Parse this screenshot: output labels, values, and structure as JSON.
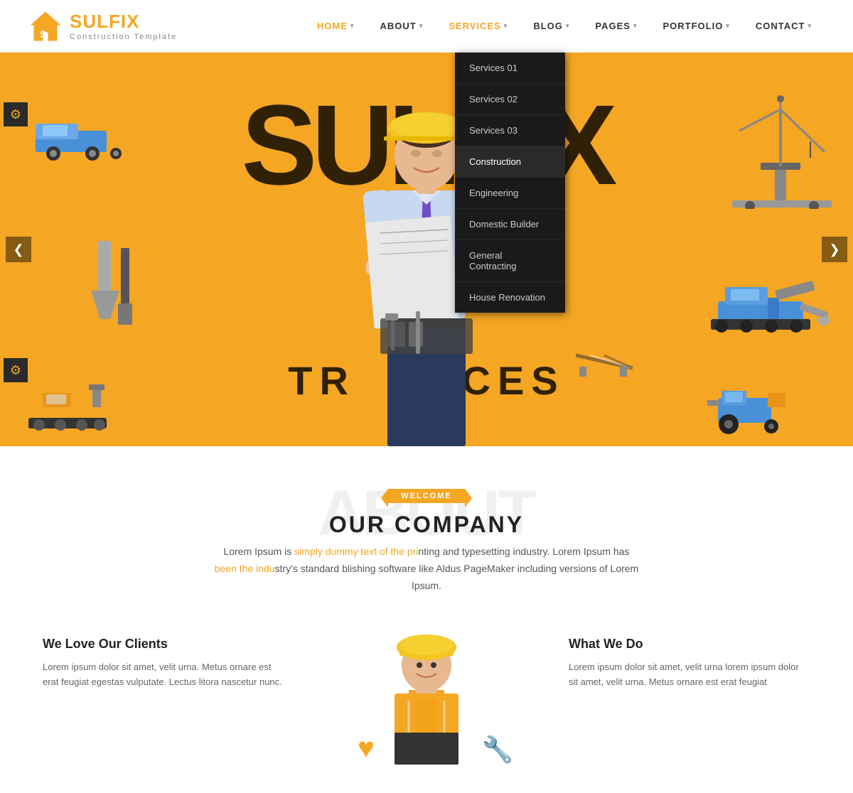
{
  "header": {
    "logo_name_part1": "SUL",
    "logo_name_part2": "FIX",
    "logo_sub": "Construction Template",
    "nav": [
      {
        "label": "HOME",
        "active": true,
        "has_dropdown": true
      },
      {
        "label": "ABOUT",
        "active": false,
        "has_dropdown": true
      },
      {
        "label": "SERVICES",
        "active": true,
        "has_dropdown": true
      },
      {
        "label": "BLOG",
        "active": false,
        "has_dropdown": true
      },
      {
        "label": "PAGES",
        "active": false,
        "has_dropdown": true
      },
      {
        "label": "PORTFOLIO",
        "active": false,
        "has_dropdown": true
      },
      {
        "label": "CONTACT",
        "active": false,
        "has_dropdown": true
      }
    ]
  },
  "services_dropdown": {
    "items": [
      {
        "label": "Services 01",
        "highlighted": false
      },
      {
        "label": "Services 02",
        "highlighted": false
      },
      {
        "label": "Services 03",
        "highlighted": false
      },
      {
        "label": "Construction",
        "highlighted": true
      },
      {
        "label": "Engineering",
        "highlighted": false
      },
      {
        "label": "Domestic Builder",
        "highlighted": false
      },
      {
        "label": "General Contracting",
        "highlighted": false
      },
      {
        "label": "House Renovation",
        "highlighted": false
      }
    ]
  },
  "hero": {
    "big_text": "SULFIX",
    "sub_text": "TR... VICES",
    "arrow_left": "❮",
    "arrow_right": "❯"
  },
  "about": {
    "welcome_badge": "WELCOME",
    "title": "OUR COMPANY",
    "bg_text": "ABOUT",
    "description": "Lorem Ipsum is simply dummy text of the printing and typesetting industry. Lorem Ipsum has been the industry's standard blishing software like Aldus PageMaker including versions of Lorem Ipsum.",
    "card1_title": "We Love Our Clients",
    "card1_desc": "Lorem ipsum dolor sit amet, velit urna. Metus ornare est erat feugiat egestas vulputate. Lectus litora nascetur nunc.",
    "card2_title": "What We Do",
    "card2_desc": "Lorem ipsum dolor sit amet, velit urna lorem ipsum dolor sit amet, velit urna. Metus ornare est erat feugiat"
  }
}
